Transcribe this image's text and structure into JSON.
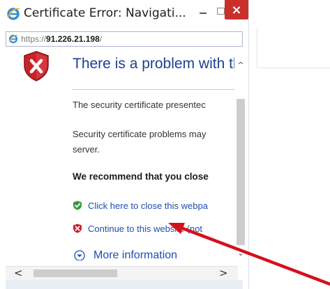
{
  "window": {
    "title": "Certificate Error: Navigati...",
    "close_label": "×"
  },
  "address_bar": {
    "url_prefix": "https://",
    "url_host": "91.226.21.198",
    "url_suffix": "/"
  },
  "page": {
    "heading": "There is a problem with thi",
    "paragraph1": "The security certificate presentec",
    "paragraph2_line1": "Security certificate problems may",
    "paragraph2_line2": "server.",
    "recommendation": "We recommend that you close",
    "close_link": "Click here to close this webpa",
    "continue_link": "Continue to this website (not",
    "more_info": "More information"
  },
  "scrollbars": {
    "up_glyph": "^",
    "down_glyph": "⌄",
    "left_glyph": "<",
    "right_glyph": ">"
  },
  "colors": {
    "heading": "#1e3f8f",
    "link": "#1e4fb0",
    "close_button": "#c9302c",
    "arrow": "#d4101c",
    "shield_red": "#c8232a",
    "check_green": "#3a9a3a"
  },
  "icons": {
    "app": "ie-logo-icon",
    "address": "ie-logo-icon",
    "shield": "shield-x-icon",
    "close_link": "green-shield-check-icon",
    "continue_link": "red-shield-x-icon",
    "more_info": "circle-chevron-down-icon"
  }
}
